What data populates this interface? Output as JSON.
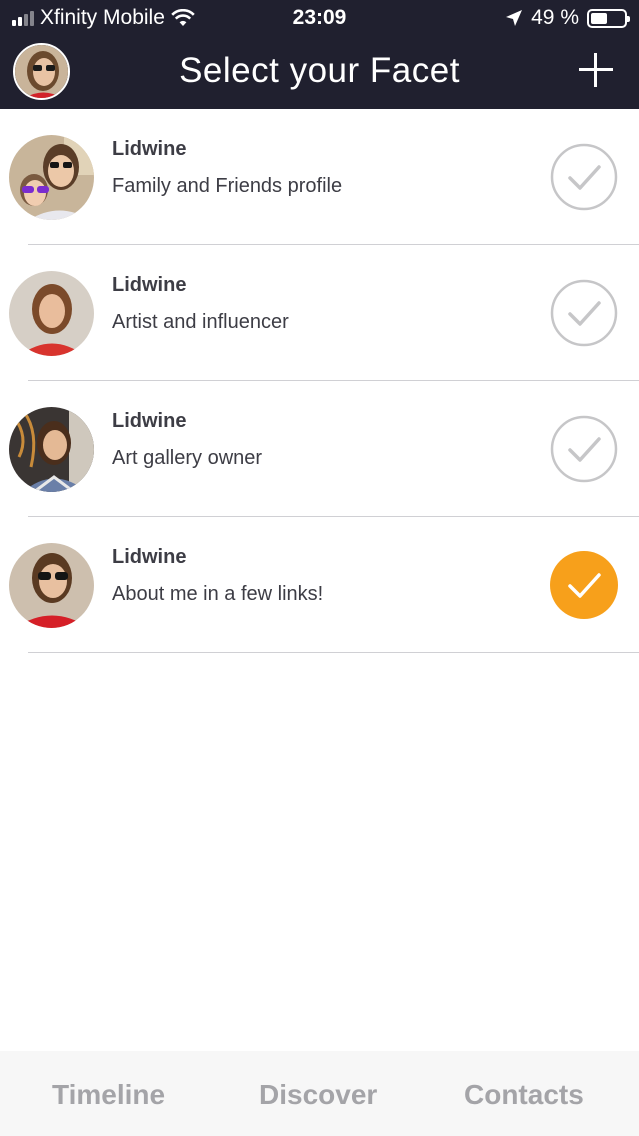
{
  "status_bar": {
    "carrier": "Xfinity Mobile",
    "time": "23:09",
    "battery": "49 %",
    "battery_level": 0.49,
    "icons": [
      "signal-icon",
      "wifi-icon",
      "location-arrow-icon",
      "battery-icon"
    ]
  },
  "nav": {
    "title": "Select your Facet",
    "avatar": "user-avatar",
    "add_icon": "plus-icon"
  },
  "facets": [
    {
      "name": "Lidwine",
      "description": "Family and Friends profile",
      "selected": false
    },
    {
      "name": "Lidwine",
      "description": "Artist and influencer",
      "selected": false
    },
    {
      "name": "Lidwine",
      "description": "Art gallery owner",
      "selected": false
    },
    {
      "name": "Lidwine",
      "description": "About me in a few links!",
      "selected": true
    }
  ],
  "tabs": [
    {
      "label": "Timeline"
    },
    {
      "label": "Discover"
    },
    {
      "label": "Contacts"
    }
  ],
  "colors": {
    "header_bg": "#20202f",
    "selected_accent": "#f7a01b",
    "check_outline": "#c6c6c8",
    "tab_text": "#a4a4a8"
  }
}
